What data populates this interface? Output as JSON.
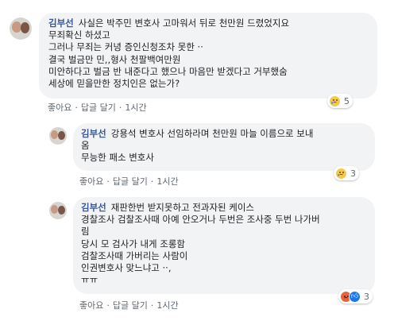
{
  "colors": {
    "author": "#385898",
    "bubble": "#f2f3f5",
    "meta": "#606770",
    "like_blue": "#1877f2"
  },
  "comments": [
    {
      "author": "김부선",
      "text": "사실은 박주민 변호사 고마워서 뒤로 천만원 드렸었지요\n무죄확신 하셨고\n그러나 무죄는 커녕 증인신청조차 못한 ··\n결국 벌금만 민,,형사 천팔백여만원\n미안하다고 벌금 반 내준다고 했으나 마음만 받겠다고 거부했숨\n세상에 믿을만한 정치인은 없는가?",
      "actions": {
        "like": "좋아요",
        "reply": "답글 달기",
        "time": "1시간"
      },
      "reactions": [
        "sad-icon"
      ],
      "reaction_count": "5"
    },
    {
      "author": "김부선",
      "text": "강용석 변호사 선임하라며 천만원 마늘 이름으로 보내\n옴\n무능한 패소 변호사",
      "actions": {
        "like": "좋아요",
        "reply": "답글 달기",
        "time": "1시간"
      },
      "reactions": [
        "sad-icon"
      ],
      "reaction_count": "3"
    },
    {
      "author": "김부선",
      "text": "재판한번 받지못하고 전과자된 케이스\n경찰조사 검찰조사때 아예 안오거나 두번은 조사중 두번 나가버\n림\n당시 모 검사가 내게 조롱함\n검찰조사때 가버리는 사람이\n인권변호사 맞느냐고 ··,\nㅠㅠ",
      "actions": {
        "like": "좋아요",
        "reply": "답글 달기",
        "time": "1시간"
      },
      "reactions": [
        "angry-icon",
        "like-icon"
      ],
      "reaction_count": "3"
    }
  ]
}
